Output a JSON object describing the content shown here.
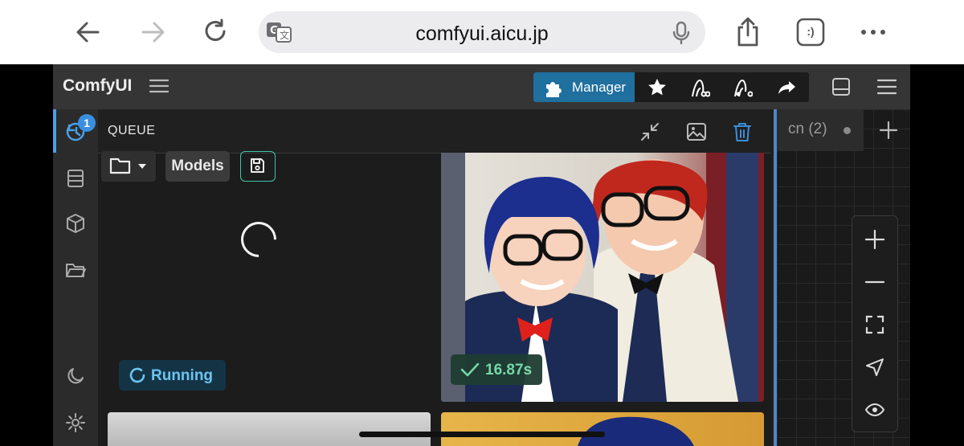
{
  "browser": {
    "url": "comfyui.aicu.jp",
    "share_text": ":)"
  },
  "app": {
    "brand": "ComfyUI",
    "toolbar": {
      "manager_label": "Manager"
    },
    "queue": {
      "title": "QUEUE",
      "badge_count": "1"
    },
    "models_label": "Models",
    "running_label": "Running",
    "result_time": "16.87s",
    "workflow_tab": {
      "label": "cn (2)"
    }
  },
  "colors": {
    "accent": "#4aa0e8",
    "manager": "#1f6f9f",
    "running_text": "#6cc4f0",
    "success_text": "#7be0ad"
  }
}
